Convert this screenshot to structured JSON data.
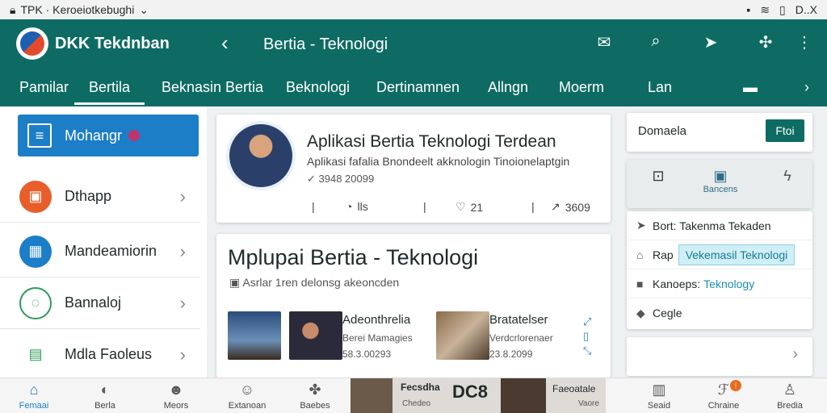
{
  "status_bar": {
    "left_text": "TPK · Keroeiotkebughi",
    "right_text": "D..X"
  },
  "header": {
    "brand": "DKK Tekdnban",
    "title": "Bertia - Teknologi"
  },
  "tabs": [
    "Pamilar",
    "Bertila",
    "Beknasin Bertia",
    "Beknologi",
    "Dertinamnen",
    "Allngn",
    "Moerm",
    "Lan"
  ],
  "sidebar": {
    "items": [
      {
        "label": "Mohangr",
        "icon": "list-icon"
      },
      {
        "label": "Dthapp",
        "icon": "image-icon",
        "color": "#e95d2b"
      },
      {
        "label": "Mandeamiorin",
        "icon": "grid-icon",
        "color": "#1c7ec7"
      },
      {
        "label": "Bannaloj",
        "icon": "chat-icon",
        "color": "#2e9c5b"
      },
      {
        "label": "Mdla Faoleus",
        "icon": "chart-icon",
        "color": "#2e9c5b"
      }
    ]
  },
  "featured": {
    "title": "Aplikasi Bertia Teknologi Terdean",
    "subtitle": "Aplikasi fafalia Bnondeelt akknologin Tinoionelaptgin",
    "meta": "3948 20099",
    "stats": [
      "lls",
      "21",
      "3609"
    ]
  },
  "news": {
    "title": "Mplupai Bertia - Teknologi",
    "subtitle": "Asrlar 1ren delonsg akeoncden",
    "items": [
      {
        "title": "Adeonthrelia",
        "subtitle": "Berei Mamagies",
        "date": "58.3.00293"
      },
      {
        "title": "Bratatelser",
        "subtitle": "Verdcrlorenaer",
        "date": "23.8.2099"
      }
    ]
  },
  "right_panel": {
    "header_label": "Domaela",
    "header_button": "Ftoi",
    "tabs": [
      {
        "label": "",
        "icon": "map-icon"
      },
      {
        "label": "Bancens",
        "icon": "bookmark-icon"
      },
      {
        "label": "",
        "icon": "flash-icon"
      }
    ],
    "rows": [
      {
        "label": "Bort: Takenma Tekaden",
        "highlight": ""
      },
      {
        "label": "Rap",
        "highlight": "Vekemasil Teknologi"
      },
      {
        "label": "Kanoeps:",
        "highlight": "Teknology"
      },
      {
        "label": "Cegle",
        "highlight": ""
      }
    ]
  },
  "bottom_nav": {
    "items": [
      "Femaai",
      "Berla",
      "Meors",
      "Extanoan",
      "Baebes",
      "Vaore",
      "Seaid",
      "Chraine",
      "Bredia"
    ],
    "promo_title": "Fecsdha",
    "promo_big": "DC8",
    "promo_side": "Faeoatale",
    "promo_sub": "Chedeo",
    "badge": "!"
  },
  "colors": {
    "primary": "#0e6b63",
    "accent": "#1c7ec7",
    "highlight": "#cfeef6"
  }
}
